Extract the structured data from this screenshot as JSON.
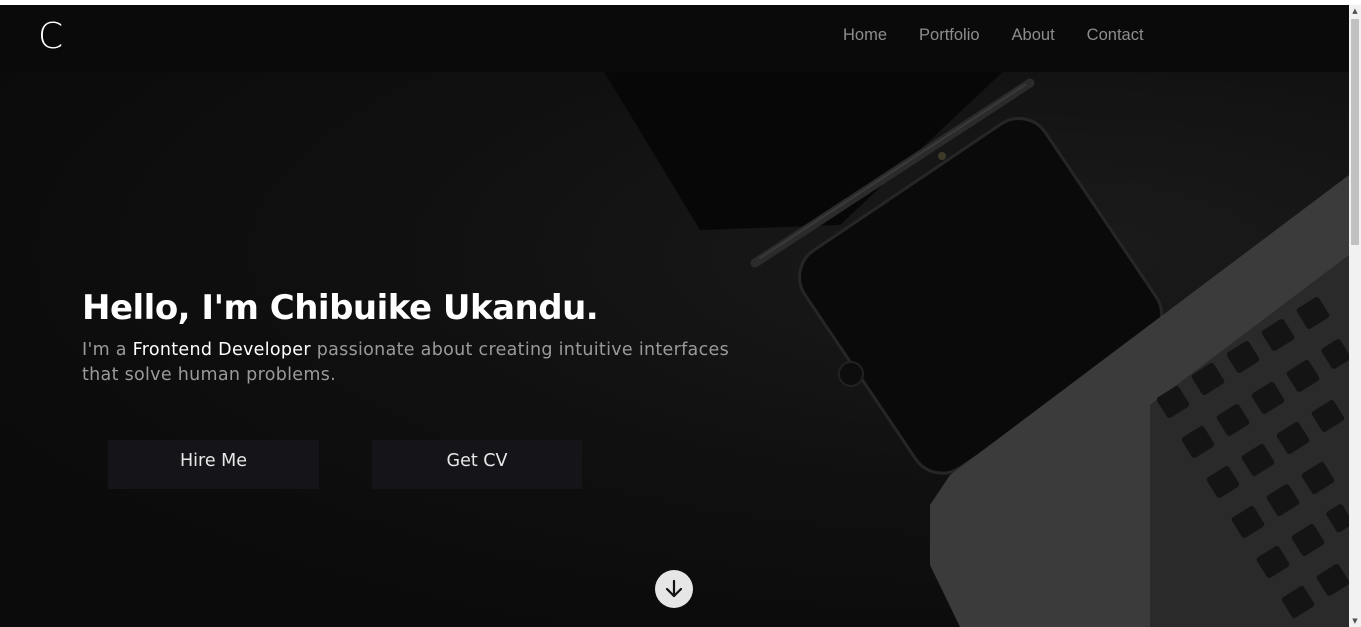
{
  "logo": {
    "letter": "C"
  },
  "nav": {
    "items": [
      "Home",
      "Portfolio",
      "About",
      "Contact"
    ]
  },
  "hero": {
    "title": "Hello, I'm Chibuike Ukandu.",
    "subtitle_prefix": "I'm a ",
    "subtitle_highlight": "Frontend Developer",
    "subtitle_rest": " passionate about creating intuitive interfaces that solve human problems."
  },
  "buttons": {
    "hire": "Hire Me",
    "cv": "Get CV"
  },
  "icons": {
    "scroll_down": "arrow-down-icon",
    "scrollbar_up": "triangle-up",
    "scrollbar_down": "triangle-down"
  },
  "colors": {
    "background": "#0c0c0c",
    "nav_text": "#8d8d8d",
    "button_bg": "#141419",
    "highlight": "#ffffff"
  }
}
